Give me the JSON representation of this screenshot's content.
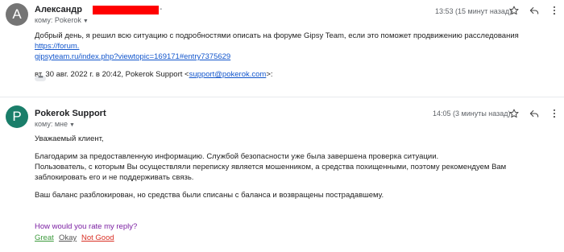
{
  "message1": {
    "avatar_letter": "A",
    "sender": "Александр",
    "sender_redacted_dot": "-",
    "to": "кому: Pokerok",
    "time": "13:53 (15 минут назад)",
    "body": "Добрый день, я решил всю ситуацию с подробностями описать на форуме Gipsy Team, если это поможет продвижению расследования ",
    "link_line1": "https://forum.",
    "link_line2": "gipsyteam.ru/index.php?viewtopic=169171#entry7375629",
    "quote_prefix": "вт, 30 авг. 2022 г. в 20:42, Pokerok Support <",
    "quote_email": "support@pokerok.com",
    "quote_suffix": ">:",
    "ellipsis": "•••"
  },
  "message2": {
    "avatar_letter": "P",
    "sender": "Pokerok Support",
    "to": "кому: мне",
    "time": "14:05 (3 минуты назад)",
    "greeting": "Уважаемый клиент,",
    "paragraph1_line1": "Благодарим за предоставленную информацию. Службой безопасности уже была завершена проверка ситуации.",
    "paragraph1_line2": "Пользователь, с которым Вы осуществляли переписку является мошенником, а средства похищенными, поэтому рекомендуем Вам заблокировать его и не поддерживать связь.",
    "paragraph2": "Ваш баланс разблокирован, но средства были списаны с баланса и возвращены пострадавшему.",
    "rating_question": "How would you rate my reply?",
    "rating_great": "Great",
    "rating_okay": "Okay",
    "rating_not_good": "Not Good"
  },
  "icons": {
    "star": "star-icon",
    "reply": "reply-icon",
    "more": "more-vert-icon",
    "caret": "caret-down-icon"
  },
  "colors": {
    "link": "#1155cc",
    "avatar_a": "#757575",
    "avatar_p": "#1a7e6a",
    "redaction": "#ff0000",
    "rating_question": "#7b1fa2",
    "rating_great": "#3c9a3c",
    "rating_not_good": "#d93025"
  }
}
